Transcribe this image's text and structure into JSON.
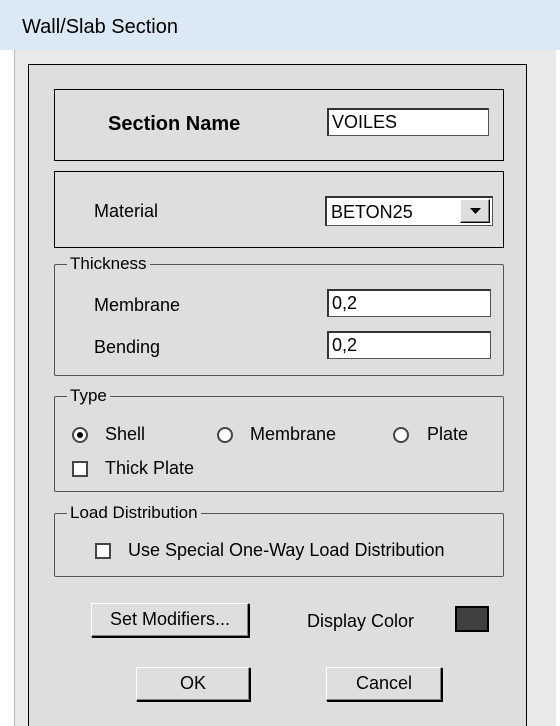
{
  "window": {
    "title": "Wall/Slab Section"
  },
  "section_name": {
    "label": "Section Name",
    "value": "VOILES"
  },
  "material": {
    "label": "Material",
    "selected": "BETON25"
  },
  "thickness": {
    "legend": "Thickness",
    "membrane_label": "Membrane",
    "membrane_value": "0,2",
    "bending_label": "Bending",
    "bending_value": "0,2"
  },
  "type": {
    "legend": "Type",
    "options": [
      {
        "label": "Shell",
        "selected": true
      },
      {
        "label": "Membrane",
        "selected": false
      },
      {
        "label": "Plate",
        "selected": false
      }
    ],
    "thick_plate_label": "Thick Plate",
    "thick_plate_checked": false
  },
  "load_distribution": {
    "legend": "Load Distribution",
    "checkbox_label": "Use Special One-Way Load Distribution",
    "checked": false
  },
  "buttons": {
    "set_modifiers": "Set Modifiers...",
    "display_color_label": "Display Color",
    "ok": "OK",
    "cancel": "Cancel"
  },
  "colors": {
    "display_color": "#404040",
    "title_bar": "#dbe8f5",
    "dialog_bg": "#dedede"
  }
}
